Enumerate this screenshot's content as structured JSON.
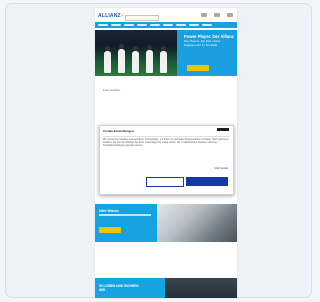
{
  "site": {
    "logo_text": "ALLIANZ",
    "logo_mark": "⚡"
  },
  "hero": {
    "title": "Power Player. Der Allianz",
    "subtitle": "Drei Teams. Ein Ziel. Unser Engagement im Fussball"
  },
  "section": {
    "label": "Fuer Kunden"
  },
  "cookie_banner": {
    "title": "Cookie-Einstellungen",
    "body": "Wir verwenden Cookies und aehnliche Technologien, um Ihnen ein optimales Nutzererlebnis zu bieten. Dazu gehoeren Cookies, die fuer den Betrieb der Seite notwendig sind, sowie solche, die zu statistischen Zwecken oder fuer Komforteinstellungen genutzt werden.",
    "link_label": "Mehr Details"
  },
  "promo1": {
    "title": "Mehr Wissen"
  },
  "promo2": {
    "title": "SO LEBEN UND WOHNEN WIR"
  },
  "colors": {
    "brand_blue": "#1aa0e0",
    "accent_yellow": "#f2c200",
    "button_blue": "#1438a8"
  }
}
